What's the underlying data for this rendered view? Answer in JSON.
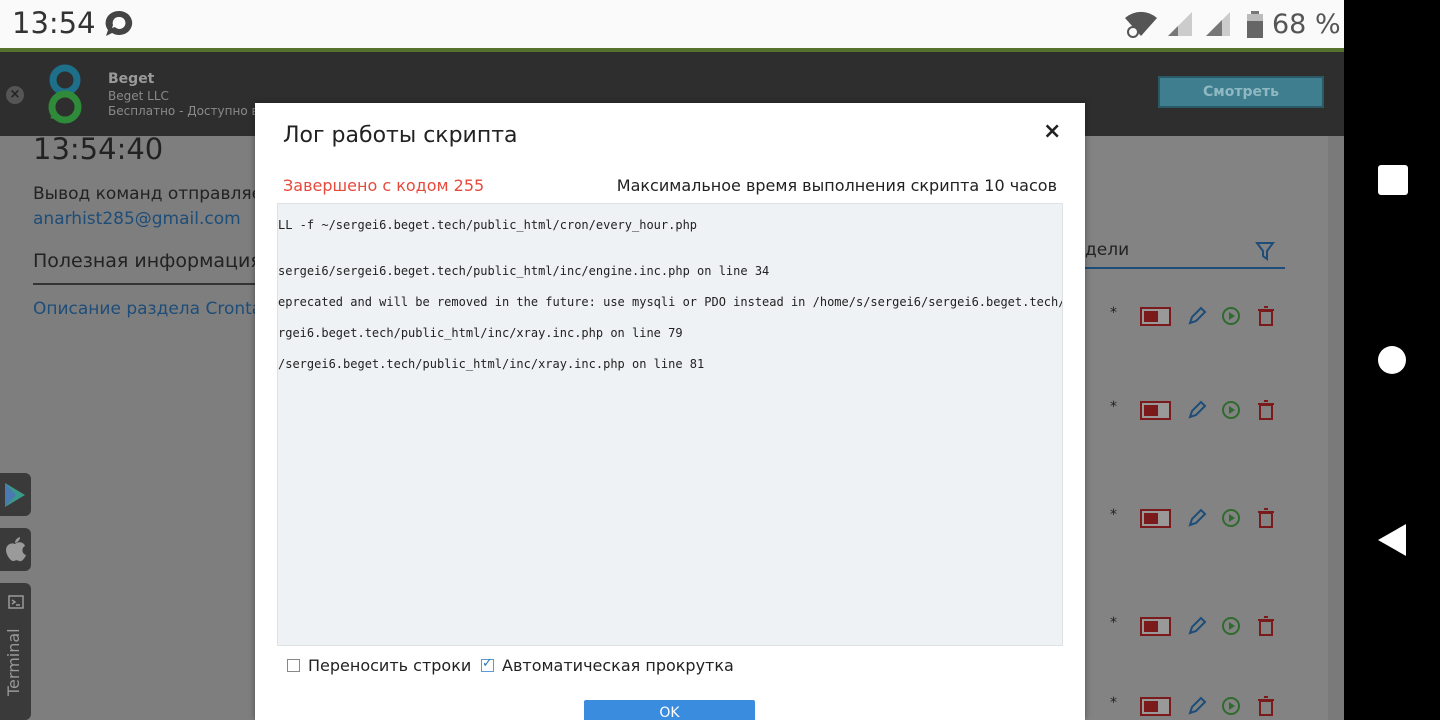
{
  "status_bar": {
    "time": "13:54",
    "battery_percent": "68 %"
  },
  "banner": {
    "app_name": "Beget",
    "developer": "Beget LLC",
    "price": "Бесплатно - Доступно в Google Play",
    "view_button": "Смотреть"
  },
  "page": {
    "clock": "13:54:40",
    "cmd_output": "Вывод команд отправляется",
    "email": "anarhist285@gmail.com",
    "useful_info": "Полезная информация",
    "crontab_desc": "Описание раздела Crontab",
    "week_label": "дели",
    "cron_rows": [
      {
        "star": "*"
      },
      {
        "star": "*"
      },
      {
        "star": "*"
      },
      {
        "star": "*"
      },
      {
        "star": "*"
      }
    ]
  },
  "side_tabs": {
    "terminal_label": "Terminal"
  },
  "modal": {
    "title": "Лог работы скрипта",
    "close": "×",
    "exit_code": "Завершено с кодом 255",
    "max_time": "Максимальное время выполнения скрипта 10 часов",
    "log_lines": [
      "LL -f ~/sergei6.beget.tech/public_html/cron/every_hour.php",
      "sergei6/sergei6.beget.tech/public_html/inc/engine.inc.php on line 34",
      "eprecated and will be removed in the future: use mysqli or PDO instead in /home/s/sergei6/sergei6.beget.tech/",
      "rgei6.beget.tech/public_html/inc/xray.inc.php on line 79",
      "/sergei6.beget.tech/public_html/inc/xray.inc.php on line 81"
    ],
    "wrap_lines_label": "Переносить строки",
    "wrap_lines_checked": false,
    "auto_scroll_label": "Автоматическая прокрутка",
    "auto_scroll_checked": true,
    "ok_button": "OK"
  },
  "colors": {
    "error": "#e64a3c",
    "link": "#1d4d78",
    "ok_button": "#3a8dde",
    "accent_green": "#56732e"
  }
}
